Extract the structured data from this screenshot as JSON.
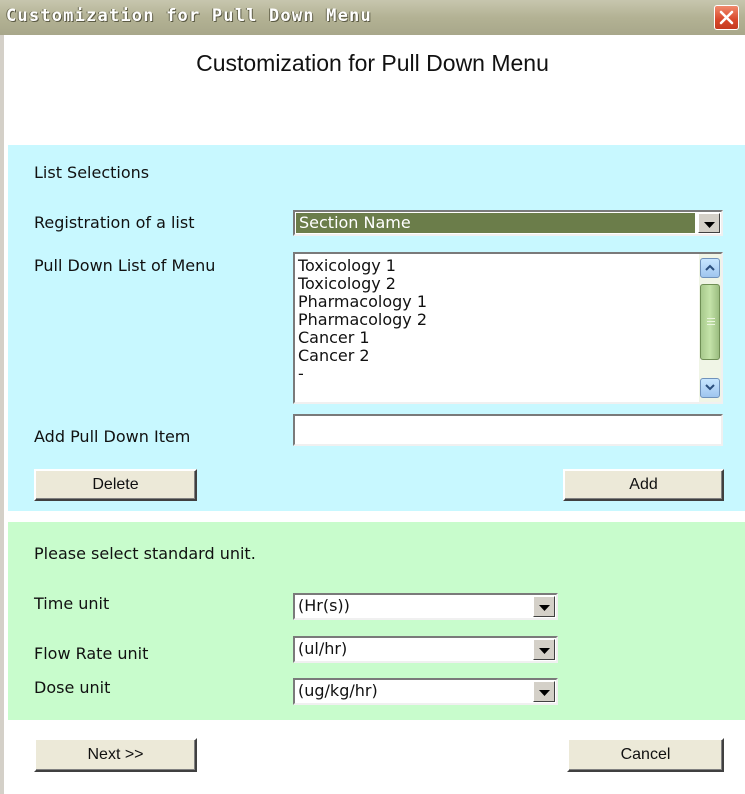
{
  "window": {
    "title": "Customization for Pull Down Menu",
    "heading": "Customization for Pull Down Menu"
  },
  "list_section": {
    "heading": "List Selections",
    "registration_label": "Registration of a list",
    "registration_value": "Section Name",
    "pulldown_label": "Pull Down List of Menu",
    "items": [
      "Toxicology 1",
      "Toxicology 2",
      "Pharmacology 1",
      "Pharmacology 2",
      "Cancer 1",
      "Cancer 2",
      "-"
    ],
    "add_item_label": "Add Pull Down Item",
    "add_item_value": "",
    "delete_button": "Delete",
    "add_button": "Add"
  },
  "unit_section": {
    "heading": "Please select standard unit.",
    "time_label": "Time unit",
    "time_value": "(Hr(s))",
    "flow_label": "Flow Rate unit",
    "flow_value": "(ul/hr)",
    "dose_label": "Dose unit",
    "dose_value": "(ug/kg/hr)"
  },
  "footer": {
    "next_button": "Next >>",
    "cancel_button": "Cancel"
  },
  "colors": {
    "list_panel_bg": "#c8f8ff",
    "unit_panel_bg": "#c8fccc",
    "selected_bg": "#6b7d4a",
    "close_button": "#d8472a"
  },
  "icons": {
    "close": "close-icon",
    "dropdown": "chevron-down-icon",
    "scroll_up": "chevron-up-icon",
    "scroll_down": "chevron-down-icon"
  }
}
